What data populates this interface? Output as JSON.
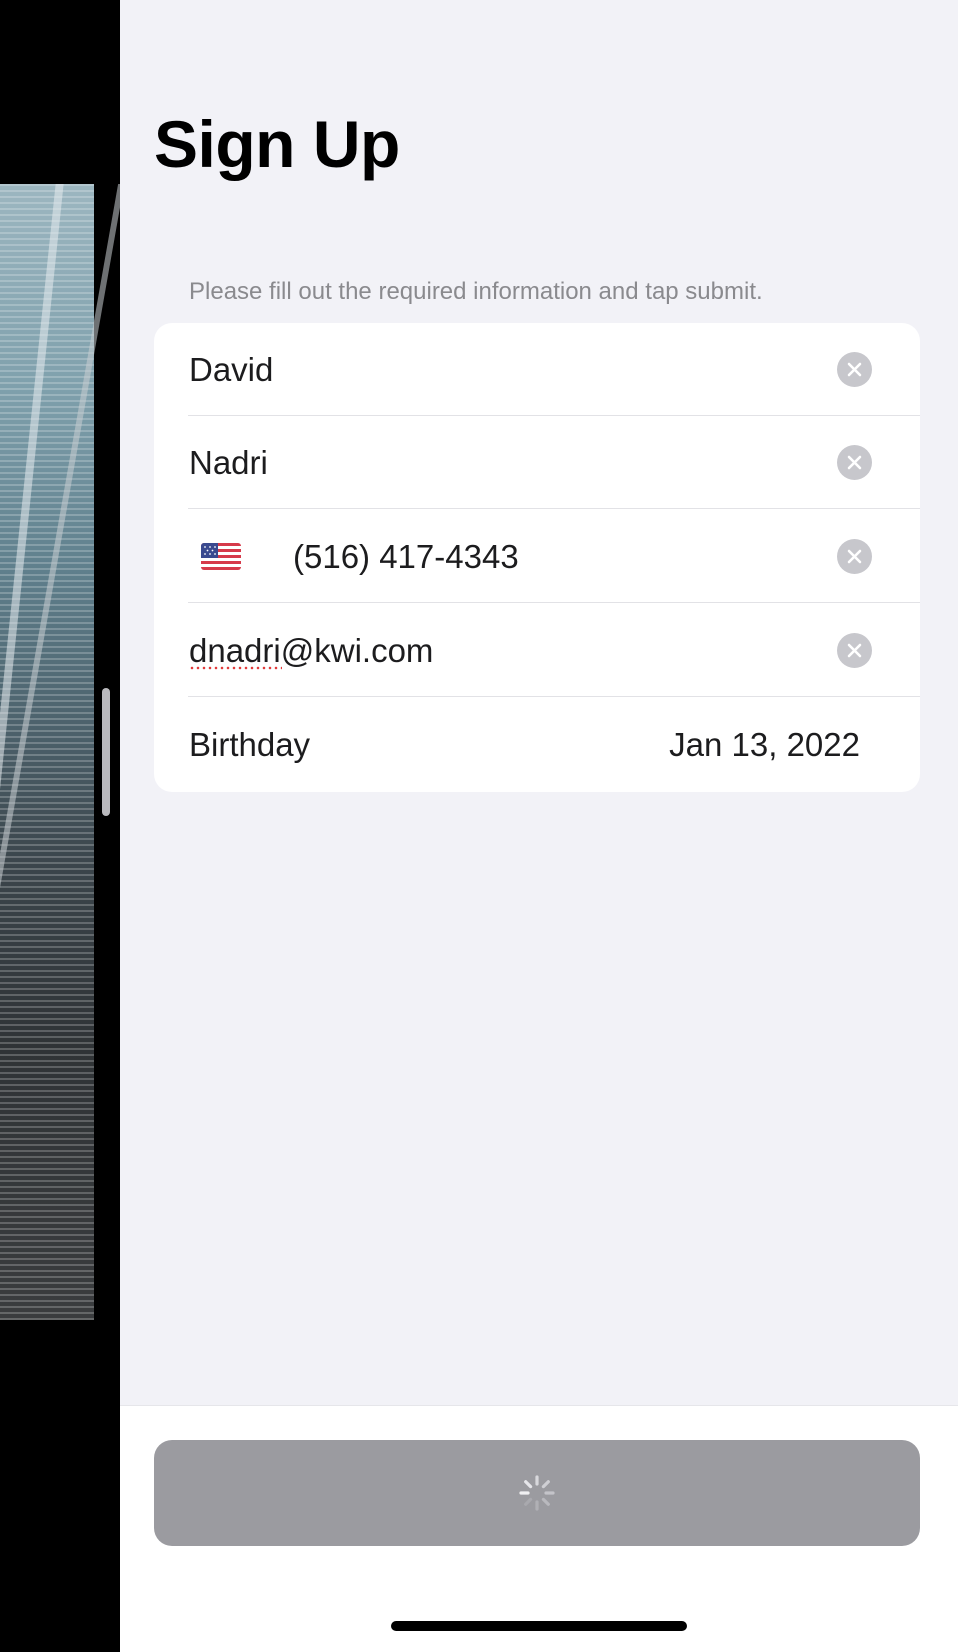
{
  "page": {
    "title": "Sign Up",
    "footer_text": "Please fill out the required information and tap submit."
  },
  "form": {
    "first_name": "David",
    "last_name": "Nadri",
    "phone": {
      "country_flag": "us-flag-icon",
      "value": "(516) 417-4343"
    },
    "email": "dnadri@kwi.com",
    "birthday": {
      "label": "Birthday",
      "value": "Jan 13, 2022"
    }
  },
  "submit": {
    "state": "loading",
    "spinner_icon": "activity-spinner-icon"
  },
  "colors": {
    "background": "#f2f2f7",
    "card": "#ffffff",
    "button_disabled": "#9b9ba0",
    "secondary_text": "#8a8a8e",
    "clear_icon": "#c7c7cc"
  }
}
